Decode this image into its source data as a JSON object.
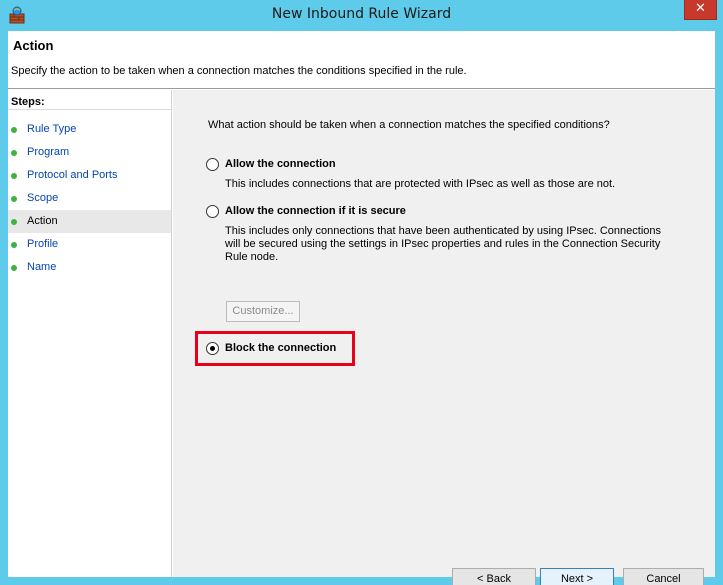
{
  "window": {
    "title": "New Inbound Rule Wizard",
    "close_glyph": "✕"
  },
  "header": {
    "title": "Action",
    "description": "Specify the action to be taken when a connection matches the conditions specified in the rule."
  },
  "steps": {
    "title": "Steps:",
    "items": [
      {
        "label": "Rule Type"
      },
      {
        "label": "Program"
      },
      {
        "label": "Protocol and Ports"
      },
      {
        "label": "Scope"
      },
      {
        "label": "Action"
      },
      {
        "label": "Profile"
      },
      {
        "label": "Name"
      }
    ],
    "active_index": 4
  },
  "content": {
    "question": "What action should be taken when a connection matches the specified conditions?",
    "options": [
      {
        "label": "Allow the connection",
        "description": [
          "This includes connections that are protected with IPsec as well as those are not."
        ],
        "selected": false
      },
      {
        "label": "Allow the connection if it is secure",
        "description": [
          "This includes only connections that have been authenticated by using IPsec.  Connections",
          "will be secured using the settings in IPsec properties and rules in the Connection Security",
          "Rule node."
        ],
        "selected": false
      },
      {
        "label": "Block the connection",
        "description": [],
        "selected": true
      }
    ],
    "customize_label": "Customize..."
  },
  "buttons": {
    "back": "< Back",
    "next": "Next >",
    "cancel": "Cancel"
  },
  "colors": {
    "accent_frame": "#5fcbea",
    "highlight": "#e8001a",
    "step_bullet": "#3fb33f"
  }
}
